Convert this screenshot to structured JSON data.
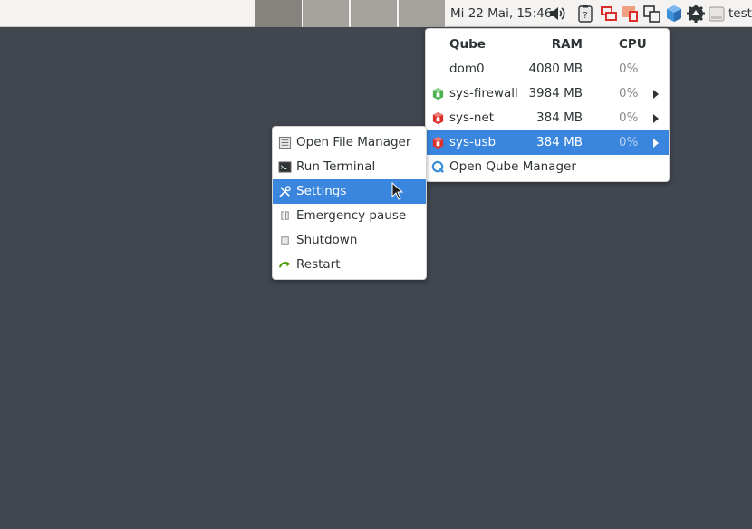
{
  "panel": {
    "clock": "Mi 22 Mai, 15:46",
    "user": "test",
    "tray_icons": [
      "volume-icon",
      "clipboard-icon",
      "network-devices-icon",
      "usb-devices-icon",
      "qubes-windows-icon",
      "qube-domains-icon",
      "updates-gear-icon",
      "disk-icon"
    ]
  },
  "qube_menu": {
    "headers": {
      "name": "Qube",
      "ram": "RAM",
      "cpu": "CPU"
    },
    "rows": [
      {
        "name": "dom0",
        "ram": "4080 MB",
        "cpu": "0%"
      },
      {
        "name": "sys-firewall",
        "ram": "3984 MB",
        "cpu": "0%"
      },
      {
        "name": "sys-net",
        "ram": "384 MB",
        "cpu": "0%"
      },
      {
        "name": "sys-usb",
        "ram": "384 MB",
        "cpu": "0%"
      }
    ],
    "manager_label": "Open Qube Manager",
    "colors": {
      "firewall": "#4caf50",
      "net_usb": "#d9302c",
      "selected": "#3a86de"
    }
  },
  "action_menu": {
    "items": [
      {
        "label": "Open File Manager",
        "icon": "file-manager-icon"
      },
      {
        "label": "Run Terminal",
        "icon": "terminal-icon"
      },
      {
        "label": "Settings",
        "icon": "settings-tools-icon"
      },
      {
        "label": "Emergency pause",
        "icon": "pause-icon"
      },
      {
        "label": "Shutdown",
        "icon": "shutdown-icon"
      },
      {
        "label": "Restart",
        "icon": "restart-icon"
      }
    ]
  }
}
